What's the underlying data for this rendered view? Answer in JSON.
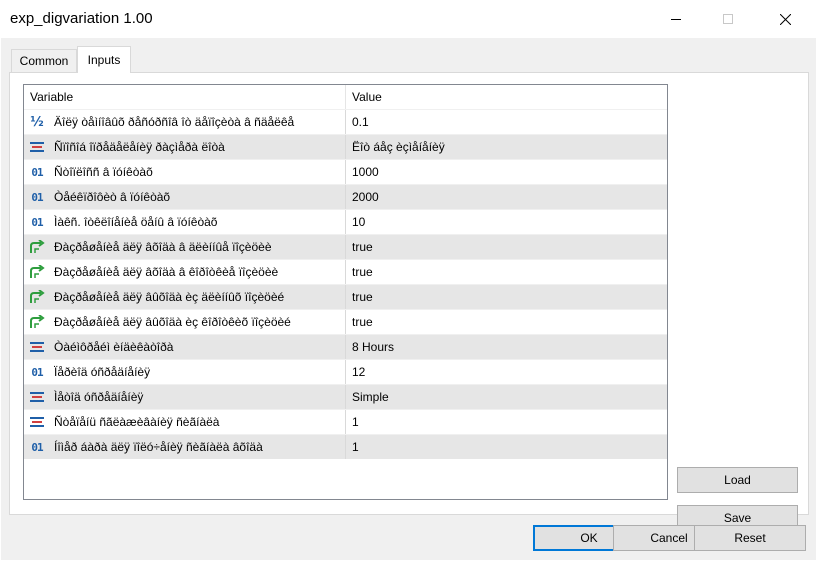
{
  "window": {
    "title": "exp_digvariation 1.00"
  },
  "tabs": [
    {
      "label": "Common",
      "active": false
    },
    {
      "label": "Inputs",
      "active": true
    }
  ],
  "grid": {
    "columns": [
      "Variable",
      "Value"
    ],
    "rows": [
      {
        "icon": "fraction-icon",
        "name": "Äîëÿ òåìíîâûõ ðåñóðñîâ îò äåïîçèòà â ñäåëêå",
        "value": "0.1"
      },
      {
        "icon": "enum-icon",
        "name": "Ñïîñîá îïðåäåëåíèÿ ðàçìåðà ëîòà",
        "value": "Ëîò áåç èçìåíåíèÿ"
      },
      {
        "icon": "integer-icon",
        "name": "Ñòîïëîññ â ïóíêòàõ",
        "value": "1000"
      },
      {
        "icon": "integer-icon",
        "name": "Òåéêïðîôèò â ïóíêòàõ",
        "value": "2000"
      },
      {
        "icon": "integer-icon",
        "name": "Ìàêñ. îòêëîíåíèå öåíû â ïóíêòàõ",
        "value": "10"
      },
      {
        "icon": "bool-icon",
        "name": "Ðàçðåøåíèå äëÿ âõîäà â äëèííûå ïîçèöèè",
        "value": "true"
      },
      {
        "icon": "bool-icon",
        "name": "Ðàçðåøåíèå äëÿ âõîäà â êîðîòêèå ïîçèöèè",
        "value": "true"
      },
      {
        "icon": "bool-icon",
        "name": "Ðàçðåøåíèå äëÿ âûõîäà èç äëèííûõ ïîçèöèé",
        "value": "true"
      },
      {
        "icon": "bool-icon",
        "name": "Ðàçðåøåíèå äëÿ âûõîäà èç êîðîòêèõ ïîçèöèé",
        "value": "true"
      },
      {
        "icon": "enum-icon",
        "name": "Òàéìôðåéì èíäèêàòîðà",
        "value": "8 Hours"
      },
      {
        "icon": "integer-icon",
        "name": "Ïåðèîä óñðåäíåíèÿ",
        "value": "12"
      },
      {
        "icon": "enum-icon",
        "name": "Ìåòîä óñðåäíåíèÿ",
        "value": "Simple"
      },
      {
        "icon": "enum-icon",
        "name": "Ñòåïåíü ñãëàæèâàíèÿ ñèãíàëà",
        "value": "1"
      },
      {
        "icon": "integer-icon",
        "name": "Íîìåð áàðà äëÿ ïîëó÷åíèÿ ñèãíàëà âõîäà",
        "value": "1"
      }
    ]
  },
  "side_buttons": {
    "load": "Load",
    "save": "Save"
  },
  "dialog_buttons": {
    "ok": "OK",
    "cancel": "Cancel",
    "reset": "Reset"
  },
  "icons": {
    "integer_glyph": "01",
    "fraction_glyph": "½"
  },
  "colors": {
    "accent": "#0078d7",
    "row_alt": "#e6e6e6",
    "icon_blue": "#1f5fa8",
    "icon_green": "#2e9e3e"
  }
}
